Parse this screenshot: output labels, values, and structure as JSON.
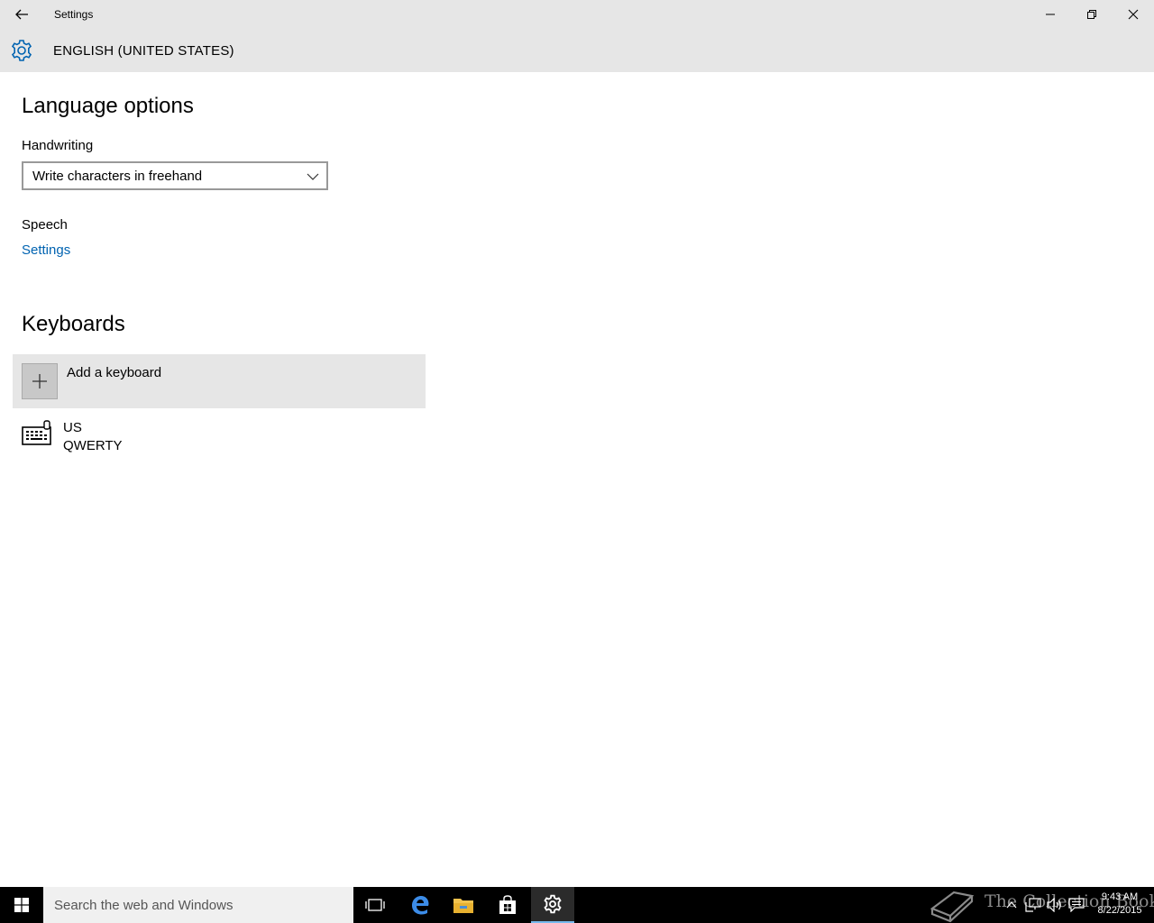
{
  "window": {
    "title": "Settings"
  },
  "header": {
    "breadcrumb": "ENGLISH (UNITED STATES)",
    "icon": "gear-icon"
  },
  "language_options": {
    "heading": "Language options",
    "handwriting_label": "Handwriting",
    "handwriting_value": "Write characters in freehand",
    "speech_label": "Speech",
    "speech_link": "Settings"
  },
  "keyboards": {
    "heading": "Keyboards",
    "add_label": "Add a keyboard",
    "items": [
      {
        "name": "US",
        "layout": "QWERTY",
        "icon": "keyboard-icon"
      }
    ]
  },
  "taskbar": {
    "search_placeholder": "Search the web and Windows",
    "watermark": "The Collection Book",
    "time": "9:43 AM",
    "date": "8/22/2015"
  },
  "colors": {
    "accent": "#0063b1",
    "titlebar_bg": "#e6e6e6",
    "taskbar_bg": "#000000"
  }
}
